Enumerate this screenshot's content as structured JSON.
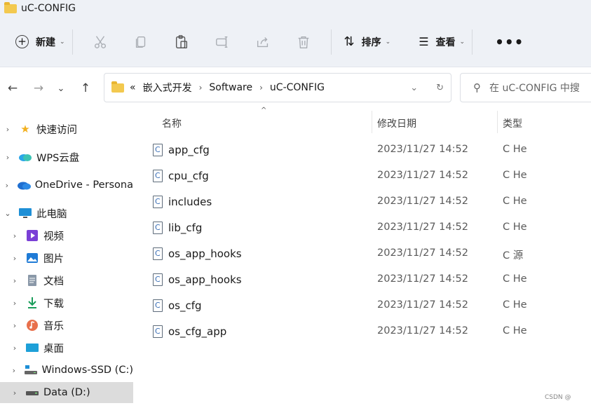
{
  "window": {
    "title": "uC-CONFIG"
  },
  "toolbar": {
    "new_label": "新建",
    "sort_label": "排序",
    "view_label": "查看",
    "more_label": "•••",
    "icons": [
      "cut-icon",
      "copy-icon",
      "paste-icon",
      "rename-icon",
      "share-icon",
      "delete-icon"
    ]
  },
  "nav": {
    "back": "←",
    "forward": "→",
    "recent": "⌄",
    "up": "↑"
  },
  "address": {
    "overflow": "«",
    "crumbs": [
      "嵌入式开发",
      "Software",
      "uC-CONFIG"
    ],
    "separator": "›"
  },
  "search": {
    "placeholder": "在 uC-CONFIG 中搜"
  },
  "sidebar": {
    "items": [
      {
        "label": "快速访问",
        "icon": "star-icon",
        "chevron": "›"
      },
      {
        "label": "WPS云盘",
        "icon": "cloud-icon",
        "chevron": "›"
      },
      {
        "label": "OneDrive - Persona",
        "icon": "onedrive-icon",
        "chevron": "›"
      },
      {
        "label": "此电脑",
        "icon": "computer-icon",
        "chevron": "⌄"
      },
      {
        "label": "视频",
        "icon": "video-icon",
        "chevron": "›"
      },
      {
        "label": "图片",
        "icon": "picture-icon",
        "chevron": "›"
      },
      {
        "label": "文档",
        "icon": "document-icon",
        "chevron": "›"
      },
      {
        "label": "下载",
        "icon": "download-icon",
        "chevron": "›"
      },
      {
        "label": "音乐",
        "icon": "music-icon",
        "chevron": "›"
      },
      {
        "label": "桌面",
        "icon": "desktop-icon",
        "chevron": "›"
      },
      {
        "label": "Windows-SSD (C:)",
        "icon": "drive-icon",
        "chevron": "›"
      },
      {
        "label": "Data (D:)",
        "icon": "drive-icon",
        "chevron": "›",
        "selected": true
      }
    ]
  },
  "columns": {
    "name": "名称",
    "modified": "修改日期",
    "type": "类型",
    "sort_indicator": "^"
  },
  "files": [
    {
      "name": "app_cfg",
      "modified": "2023/11/27 14:52",
      "type": "C He"
    },
    {
      "name": "cpu_cfg",
      "modified": "2023/11/27 14:52",
      "type": "C He"
    },
    {
      "name": "includes",
      "modified": "2023/11/27 14:52",
      "type": "C He"
    },
    {
      "name": "lib_cfg",
      "modified": "2023/11/27 14:52",
      "type": "C He"
    },
    {
      "name": "os_app_hooks",
      "modified": "2023/11/27 14:52",
      "type": "C 源"
    },
    {
      "name": "os_app_hooks",
      "modified": "2023/11/27 14:52",
      "type": "C He"
    },
    {
      "name": "os_cfg",
      "modified": "2023/11/27 14:52",
      "type": "C He"
    },
    {
      "name": "os_cfg_app",
      "modified": "2023/11/27 14:52",
      "type": "C He"
    }
  ],
  "watermark": "CSDN @"
}
